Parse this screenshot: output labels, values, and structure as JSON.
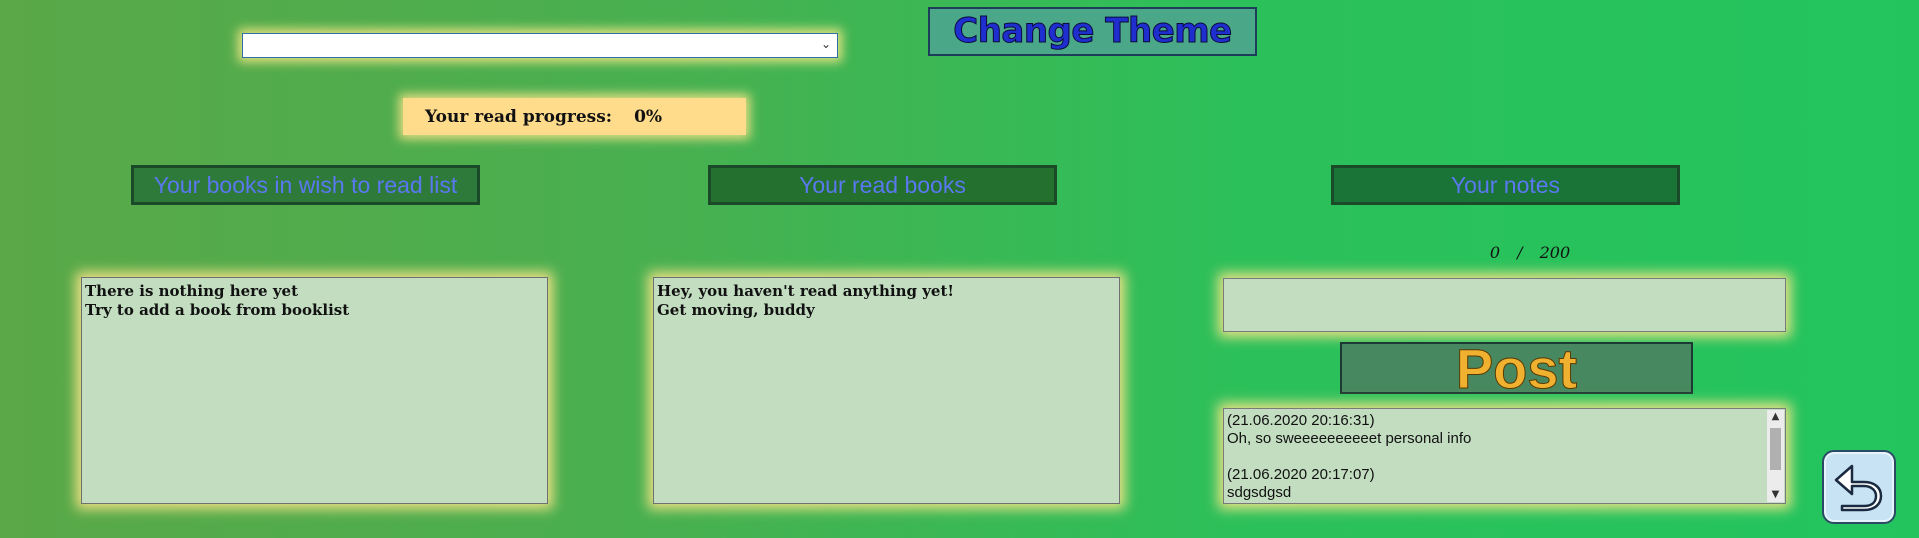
{
  "theme": {
    "select_value": "",
    "change_theme_label": "Change Theme"
  },
  "progress": {
    "label": "Your read progress:",
    "value": "0%"
  },
  "sections": {
    "wish": {
      "header": "Your books in wish to read list",
      "lines": [
        "There is nothing here yet",
        "Try to add a book from booklist"
      ]
    },
    "read": {
      "header": "Your read books",
      "lines": [
        "Hey, you haven't read anything yet!",
        "Get moving, buddy"
      ]
    },
    "notes": {
      "header": "Your notes",
      "counter": "0 / 200",
      "input_value": "",
      "post_label": "Post",
      "entries": [
        {
          "timestamp": "(21.06.2020 20:16:31)",
          "text": "Oh, so sweeeeeeeeeet personal info"
        },
        {
          "timestamp": "(21.06.2020 20:17:07)",
          "text": "sdgsdgsd"
        }
      ]
    }
  },
  "icons": {
    "dropdown": "chevron-down-icon",
    "back": "back-arrow-icon",
    "scroll_up": "scroll-up-icon",
    "scroll_down": "scroll-down-icon"
  },
  "colors": {
    "background_start": "#5aa848",
    "background_end": "#23c45e",
    "section_header_text": "#5a78f0",
    "panel_bg": "#c2ddc0",
    "progress_bg": "#ffdc8c",
    "post_text": "#f0b030",
    "change_theme_text": "#1f2fcf"
  }
}
